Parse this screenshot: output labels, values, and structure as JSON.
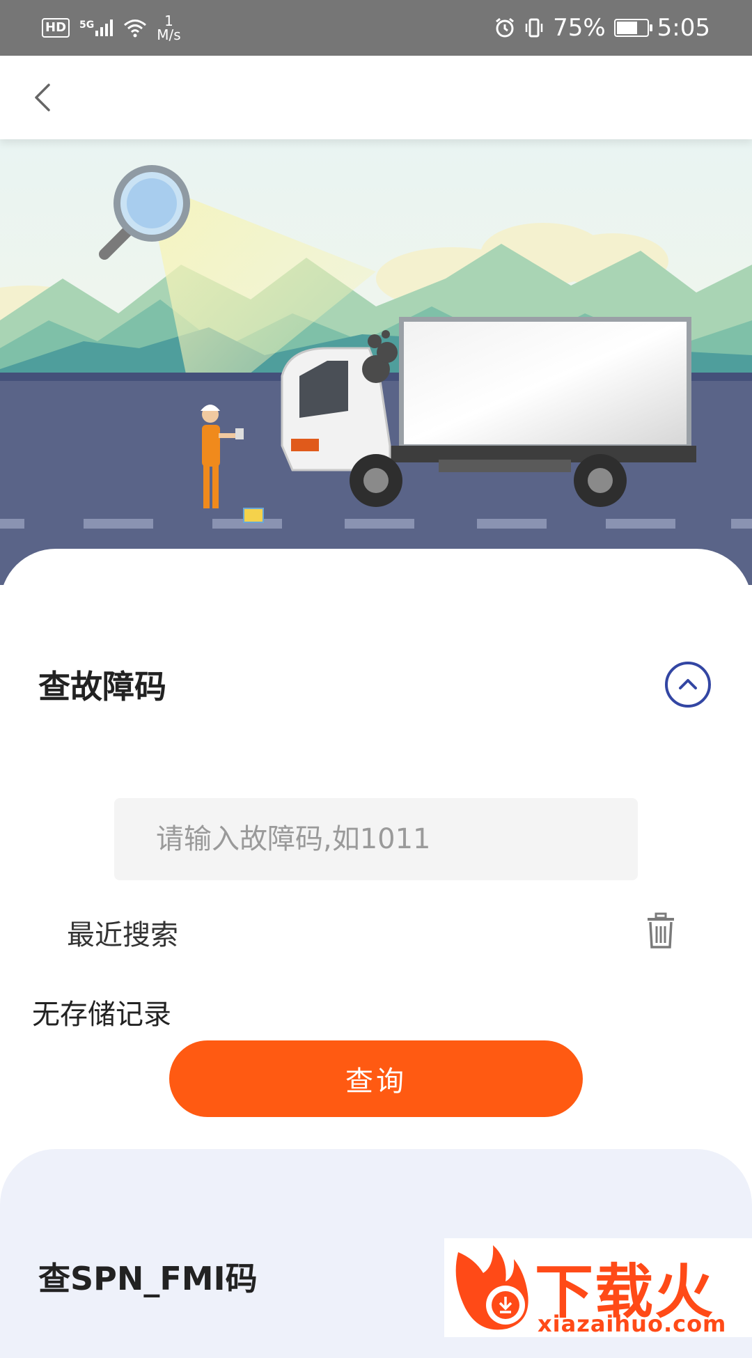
{
  "status_bar": {
    "hd": "HD",
    "signal": "5G",
    "net_speed_value": "1",
    "net_speed_unit": "M/s",
    "battery_percent": "75%",
    "battery_level": 0.75,
    "time": "5:05"
  },
  "fault_code": {
    "title": "查故障码",
    "input_placeholder": "请输入故障码,如1011",
    "recent_label": "最近搜索",
    "empty_text": "无存储记录",
    "query_button": "查询"
  },
  "spn_fmi": {
    "title": "查SPN_FMI码"
  },
  "watermark": {
    "text": "下载火",
    "url": "xiazaihuo.com"
  },
  "colors": {
    "accent": "#ff5a12",
    "collapse_icon": "#3346a3",
    "status_bar": "#767676",
    "spn_card_bg": "#eef1fa"
  }
}
